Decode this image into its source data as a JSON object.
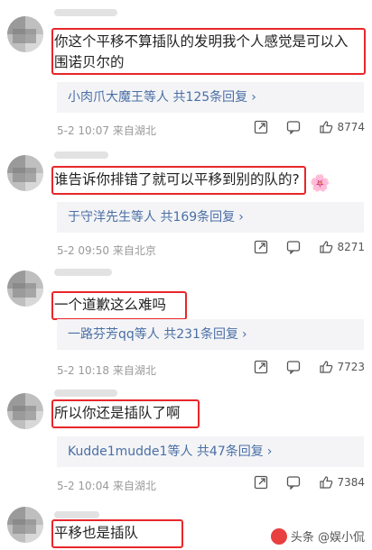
{
  "comments": [
    {
      "text": "你这个平移不算插队的发明我个人感觉是可以入围诺贝尔的",
      "replies": "小肉爪大魔王等人",
      "reply_count": "共125条回复",
      "time": "5-2 10:07",
      "location": "来自湖北",
      "likes": "8774"
    },
    {
      "text": "谁告诉你排错了就可以平移到别的队的?",
      "replies": "于守洋先生等人",
      "reply_count": "共169条回复",
      "time": "5-2 09:50",
      "location": "来自北京",
      "likes": "8271"
    },
    {
      "text": "一个道歉这么难吗",
      "replies": "一路芬芳qq等人",
      "reply_count": "共231条回复",
      "time": "5-2 10:18",
      "location": "来自湖北",
      "likes": "7723"
    },
    {
      "text": "所以你还是插队了啊",
      "replies": "Kudde1mudde1等人",
      "reply_count": "共47条回复",
      "time": "5-2 10:04",
      "location": "来自湖北",
      "likes": "7384"
    },
    {
      "text": "平移也是插队"
    }
  ],
  "watermark": "头条 @娱小侃",
  "colors": {
    "highlight": "#e8262a",
    "link": "#4a6fa5"
  }
}
